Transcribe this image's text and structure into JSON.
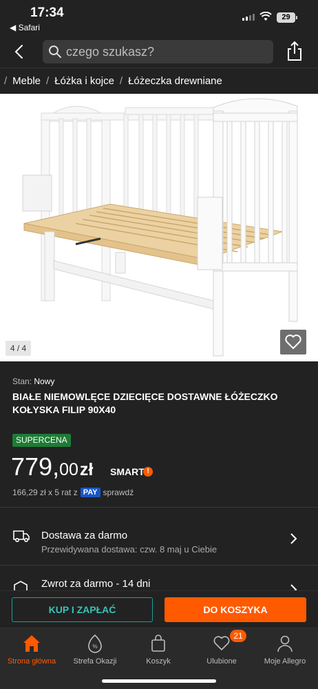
{
  "status": {
    "time": "17:34",
    "back_app": "◀ Safari",
    "battery": "29"
  },
  "search": {
    "placeholder": "czego szukasz?"
  },
  "breadcrumb": [
    "Meble",
    "Łóżka i kojce",
    "Łóżeczka drewniane"
  ],
  "gallery": {
    "counter": "4 / 4"
  },
  "product": {
    "condition_label": "Stan:",
    "condition_value": "Nowy",
    "title": "BIAŁE NIEMOWLĘCE DZIECIĘCE DOSTAWNE ŁÓŻECZKO KOŁYSKA FILIP 90x40",
    "badge": "SUPERCENA",
    "price_main": "779,",
    "price_cents": "00",
    "price_currency": "zł",
    "smart": "SMART",
    "installments": "166,29 zł x 5 rat z",
    "pay": "PAY",
    "check": "sprawdź"
  },
  "delivery": {
    "title": "Dostawa za darmo",
    "subtitle": "Przewidywana dostawa: czw. 8 maj u Ciebie"
  },
  "returns": {
    "title": "Zwrot za darmo - 14 dni"
  },
  "actions": {
    "buy": "KUP I ZAPŁAĆ",
    "cart": "DO KOSZYKA"
  },
  "tabs": [
    {
      "label": "Strona główna",
      "icon": "home-icon"
    },
    {
      "label": "Strefa Okazji",
      "icon": "deals-icon"
    },
    {
      "label": "Koszyk",
      "icon": "cart-icon"
    },
    {
      "label": "Ulubione",
      "icon": "heart-icon"
    },
    {
      "label": "Moje Allegro",
      "icon": "user-icon"
    }
  ],
  "favorites_count": "21",
  "colors": {
    "accent": "#ff5a00",
    "background": "#222222",
    "badge": "#1e7b35",
    "teal": "#1aa09a"
  }
}
